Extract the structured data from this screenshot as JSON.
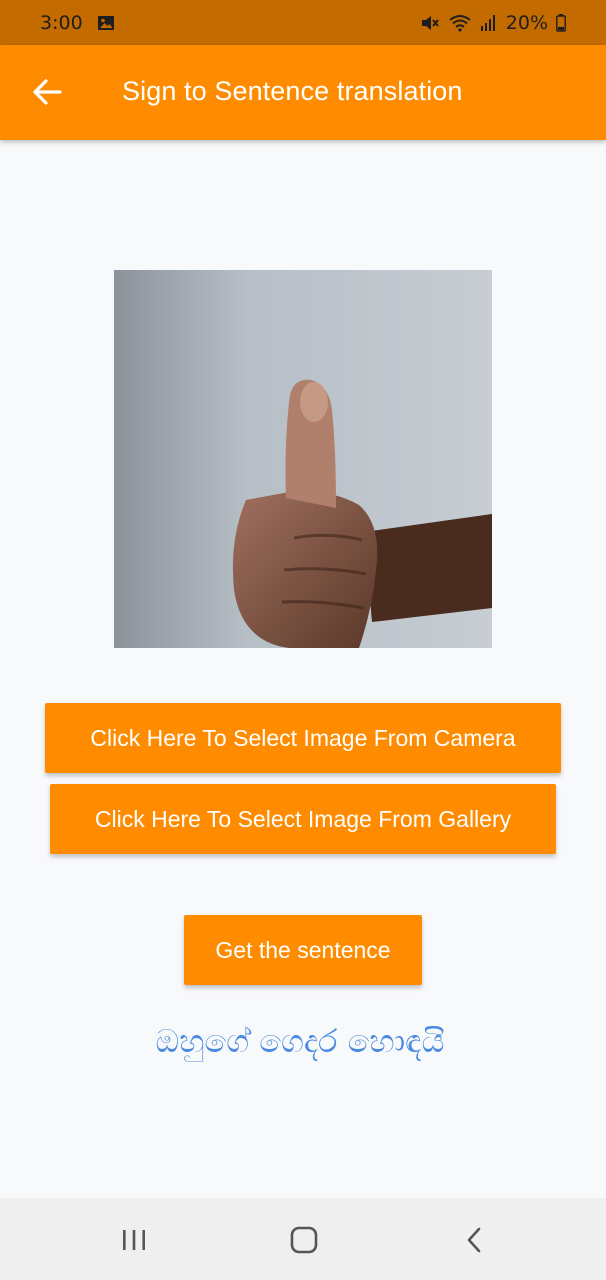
{
  "status_bar": {
    "time": "3:00",
    "battery": "20%",
    "icons": [
      "image-notification-icon",
      "mute-icon",
      "wifi-icon",
      "signal-icon",
      "battery-icon"
    ]
  },
  "app_bar": {
    "title": "Sign to Sentence translation",
    "back_icon": "arrow-left-icon"
  },
  "buttons": {
    "camera": "Click Here To Select Image From Camera",
    "gallery": "Click Here To Select Image From Gallery",
    "sentence": "Get the sentence"
  },
  "result": {
    "text": "ඔහුගේ ගෙදර හොඳයි"
  },
  "nav_bar": {
    "icons": [
      "recents-icon",
      "home-icon",
      "back-chevron-icon"
    ]
  },
  "colors": {
    "status_bar": "#c46b00",
    "accent": "#ff8c00",
    "result_text": "#4a8ae0",
    "background": "#f8f9fa"
  }
}
